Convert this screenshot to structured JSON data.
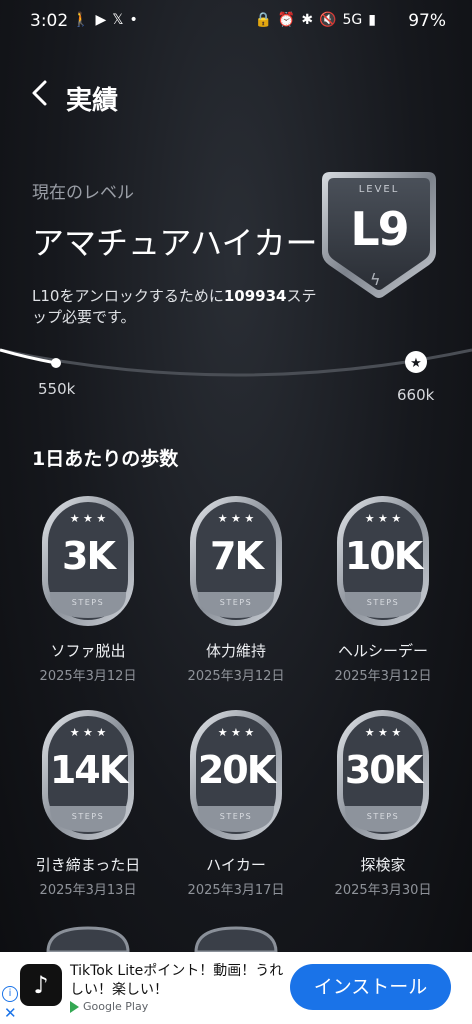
{
  "status_bar": {
    "time": "3:02",
    "left_icons": [
      "walk-icon",
      "youtube-icon",
      "x-icon",
      "dot-icon"
    ],
    "right_icons": [
      "lock-icon",
      "alarm-icon",
      "bluetooth-icon",
      "mute-icon",
      "5g-icon",
      "signal-icon"
    ],
    "battery": "97%"
  },
  "header": {
    "title": "実績"
  },
  "level": {
    "caption": "現在のレベル",
    "name": "アマチュアハイカー",
    "desc_prefix": "L10をアンロックするために",
    "desc_steps": "109934",
    "desc_suffix": "ステップ必要です。",
    "badge_label": "LEVEL",
    "badge_value": "L9"
  },
  "progress": {
    "start_label": "550k",
    "end_label": "660k"
  },
  "section": {
    "title": "1日あたりの歩数"
  },
  "medal_steps_label": "STEPS",
  "achievements": [
    {
      "value": "3K",
      "name": "ソファ脱出",
      "date": "2025年3月12日"
    },
    {
      "value": "7K",
      "name": "体力維持",
      "date": "2025年3月12日"
    },
    {
      "value": "10K",
      "name": "ヘルシーデー",
      "date": "2025年3月12日"
    },
    {
      "value": "14K",
      "name": "引き締まった日",
      "date": "2025年3月13日"
    },
    {
      "value": "20K",
      "name": "ハイカー",
      "date": "2025年3月17日"
    },
    {
      "value": "30K",
      "name": "探検家",
      "date": "2025年3月30日"
    }
  ],
  "ad": {
    "app_text": "TikTok Liteポイント！動画！うれしい！楽しい！",
    "store": "Google Play",
    "install": "インストール"
  },
  "colors": {
    "background": "#16181d",
    "accent": "#1a73e8",
    "medal_face": "#3a3f48"
  }
}
